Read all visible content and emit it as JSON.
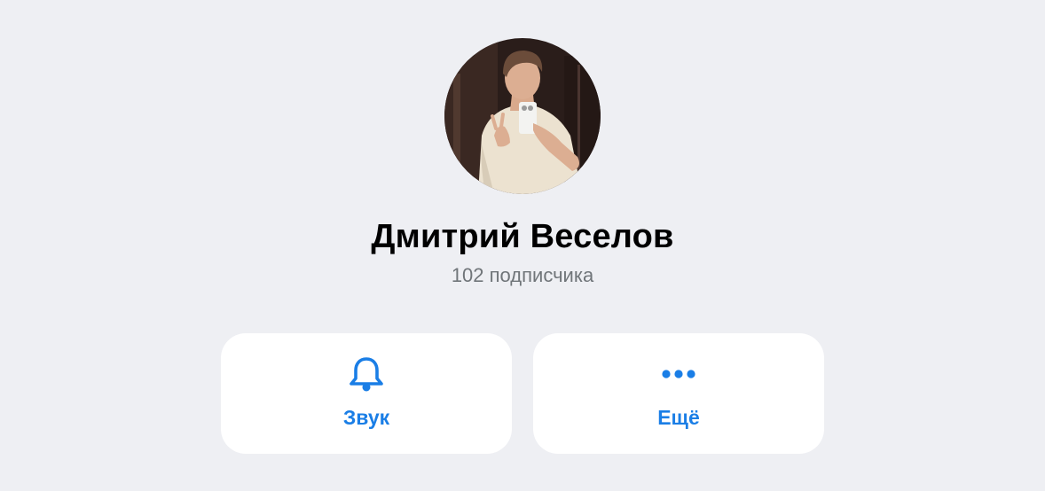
{
  "profile": {
    "name": "Дмитрий Веселов",
    "subscribers": "102 подписчика"
  },
  "actions": [
    {
      "label": "Звук",
      "icon": "bell-icon"
    },
    {
      "label": "Ещё",
      "icon": "more-dots-icon"
    }
  ],
  "colors": {
    "background": "#eeeff3",
    "accent": "#1a7ee6",
    "secondary_text": "#707579",
    "button_bg": "#ffffff"
  }
}
